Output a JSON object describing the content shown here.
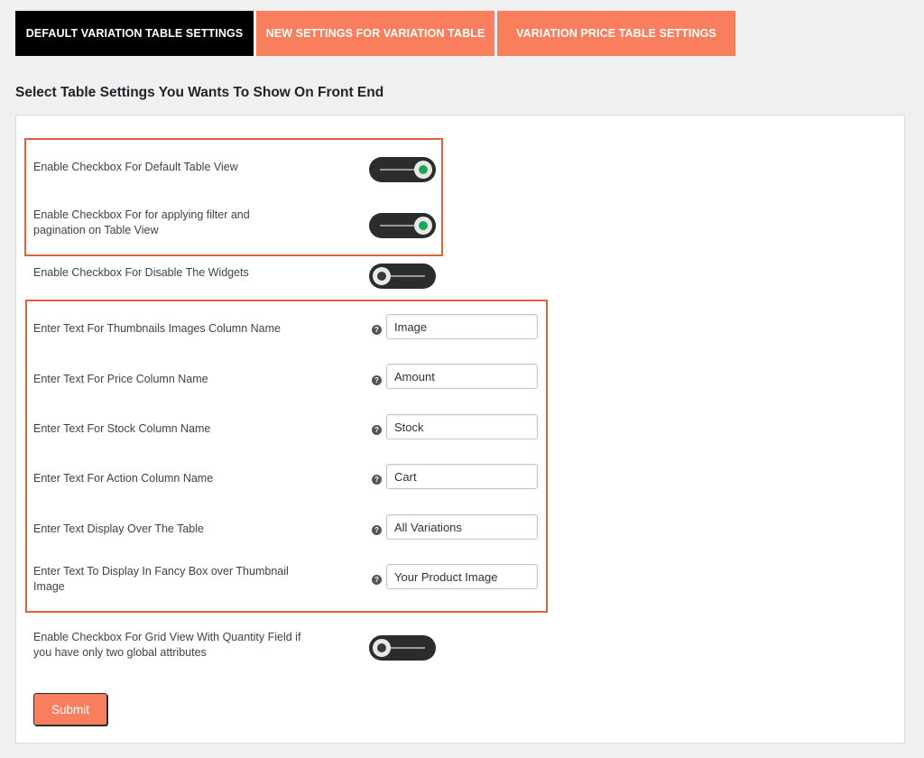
{
  "tabs": [
    {
      "label": "DEFAULT VARIATION TABLE SETTINGS",
      "active": true
    },
    {
      "label": "NEW SETTINGS FOR VARIATION TABLE",
      "active": false
    },
    {
      "label": "VARIATION PRICE TABLE SETTINGS",
      "active": false
    }
  ],
  "section_title": "Select Table Settings You Wants To Show On Front End",
  "toggles": [
    {
      "label": "Enable Checkbox For Default Table View",
      "state": "on"
    },
    {
      "label": "Enable Checkbox For for applying filter and pagination on Table View",
      "state": "on"
    },
    {
      "label": "Enable Checkbox For Disable The Widgets",
      "state": "off"
    },
    {
      "label": "Enable Checkbox For Grid View With Quantity Field if you have only two global attributes",
      "state": "off"
    }
  ],
  "text_fields": [
    {
      "label": "Enter Text For Thumbnails Images Column Name",
      "value": "Image",
      "help_icon": "question-circle-icon"
    },
    {
      "label": "Enter Text For Price Column Name",
      "value": "Amount",
      "help_icon": "question-circle-icon"
    },
    {
      "label": "Enter Text For Stock Column Name",
      "value": "Stock",
      "help_icon": "question-circle-icon"
    },
    {
      "label": "Enter Text For Action Column Name",
      "value": "Cart",
      "help_icon": "question-circle-icon"
    },
    {
      "label": "Enter Text Display Over The Table",
      "value": "All Variations",
      "help_icon": "question-circle-icon"
    },
    {
      "label": "Enter Text To Display In Fancy Box over Thumbnail Image",
      "value": "Your Product Image",
      "help_icon": "question-circle-icon"
    }
  ],
  "help_glyph": "?",
  "submit_label": "Submit",
  "colors": {
    "active_tab": "#000000",
    "inactive_tab": "#f97e5e",
    "highlight_border": "#e0623b",
    "toggle_on_dot": "#1fa65a",
    "toggle_body": "#2c2c2c"
  }
}
